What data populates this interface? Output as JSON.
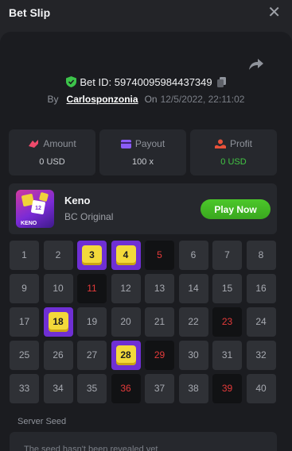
{
  "header": {
    "title": "Bet Slip",
    "close_icon": "close-icon"
  },
  "bet": {
    "id_text": "Bet ID: 59740095984437349",
    "by_label": "By",
    "user": "Carlosponzonia",
    "on_label": "On",
    "datetime": "12/5/2022, 22:11:02"
  },
  "stats": {
    "amount": {
      "label": "Amount",
      "value": "0 USD",
      "color": "#ef4a6b"
    },
    "payout": {
      "label": "Payout",
      "value": "100 x",
      "color": "#8a5cf5"
    },
    "profit": {
      "label": "Profit",
      "value": "0 USD",
      "color": "#e8513a"
    }
  },
  "game": {
    "name": "Keno",
    "subtitle": "BC Original",
    "thumb_caption": "KENO",
    "play_label": "Play Now"
  },
  "board": {
    "numbers": [
      "1",
      "2",
      "3",
      "4",
      "5",
      "6",
      "7",
      "8",
      "9",
      "10",
      "11",
      "12",
      "13",
      "14",
      "15",
      "16",
      "17",
      "18",
      "19",
      "20",
      "21",
      "22",
      "23",
      "24",
      "25",
      "26",
      "27",
      "28",
      "29",
      "30",
      "31",
      "32",
      "33",
      "34",
      "35",
      "36",
      "37",
      "38",
      "39",
      "40"
    ],
    "hits": [
      3,
      4,
      18,
      28
    ],
    "drawn_misses": [
      5,
      11,
      23,
      29,
      36,
      39
    ]
  },
  "seed": {
    "label": "Server Seed",
    "text": "The seed hasn't been revealed yet"
  },
  "colors": {
    "accent_green": "#42c544",
    "hit_purple": "#6f2fd4",
    "gem_yellow": "#f3d93a",
    "miss_red": "#e53a3a"
  }
}
